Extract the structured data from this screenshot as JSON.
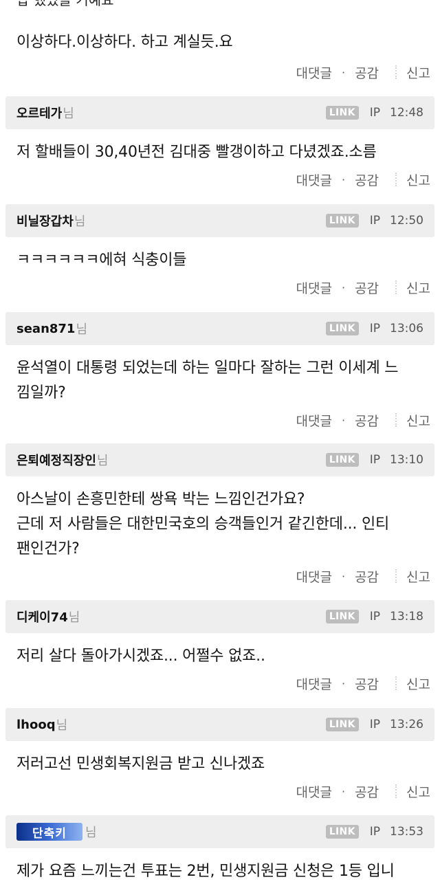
{
  "top_fragment": "답 했었을 거예요",
  "first_body": "이상하다.이상하다. 하고 계실듯.요",
  "actions": {
    "reply": "대댓글",
    "like": "공감",
    "report": "신고"
  },
  "badge": "LINK",
  "ip_label": "IP",
  "nim": "님",
  "comments": [
    {
      "nick": "오르테가",
      "time": "12:48",
      "body": "저 할배들이 30,40년전 김대중 빨갱이하고 다녔겠죠.소름"
    },
    {
      "nick": "비닐장갑차",
      "time": "12:50",
      "body": "ㅋㅋㅋㅋㅋㅋ에혀 식충이들"
    },
    {
      "nick": "sean871",
      "time": "13:06",
      "body": "윤석열이 대통령 되었는데 하는 일마다 잘하는 그런 이세계 느\n낌일까?"
    },
    {
      "nick": "은퇴예정직장인",
      "time": "13:10",
      "body": "아스날이 손흥민한테 쌍욕 박는 느낌인건가요?\n근데 저 사람들은 대한민국호의 승객들인거 같긴한데... 인티\n팬인건가?"
    },
    {
      "nick": "디케이74",
      "time": "13:18",
      "body": "저리 살다 돌아가시겠죠... 어쩔수 없죠.."
    },
    {
      "nick": "lhooq",
      "time": "13:26",
      "body": "저러고선 민생회복지원금 받고 신나겠죠"
    },
    {
      "nick": "단축키",
      "time": "13:53",
      "body": "제가 요즘 느끼는건 투표는 2번, 민생지원금 신청은 1등 입니"
    }
  ]
}
